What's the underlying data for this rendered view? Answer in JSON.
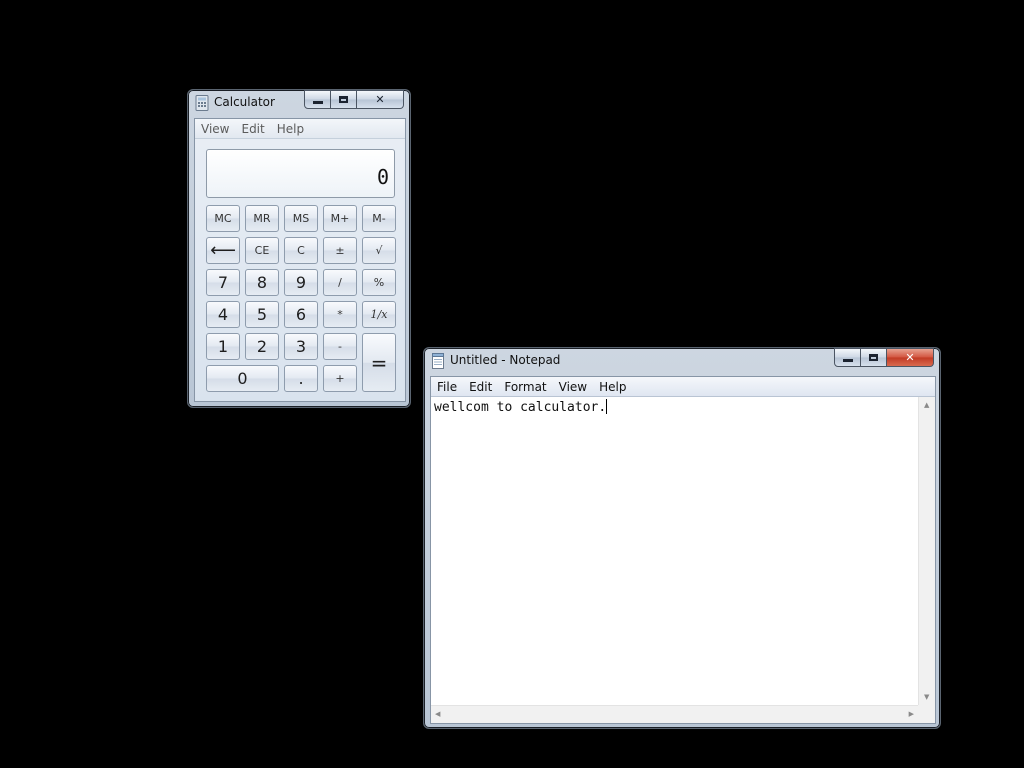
{
  "calculator": {
    "title": "Calculator",
    "menu": [
      "View",
      "Edit",
      "Help"
    ],
    "display_value": "0",
    "buttons": {
      "mc": "MC",
      "mr": "MR",
      "ms": "MS",
      "mplus": "M+",
      "mminus": "M-",
      "backspace": "⟵",
      "ce": "CE",
      "c": "C",
      "plusminus": "±",
      "sqrt": "√",
      "n7": "7",
      "n8": "8",
      "n9": "9",
      "divide": "/",
      "percent": "%",
      "n4": "4",
      "n5": "5",
      "n6": "6",
      "multiply": "*",
      "reciprocal": "1/x",
      "n1": "1",
      "n2": "2",
      "n3": "3",
      "minus": "-",
      "equals": "=",
      "n0": "0",
      "decimal": ".",
      "plus": "+"
    }
  },
  "notepad": {
    "title": "Untitled - Notepad",
    "menu": [
      "File",
      "Edit",
      "Format",
      "View",
      "Help"
    ],
    "content": "wellcom to calculator."
  },
  "icons": {
    "minimize": "minimize-icon",
    "maximize": "maximize-icon",
    "close": "close-icon",
    "calculator_app": "calculator-icon",
    "notepad_app": "notepad-icon",
    "scroll_up": "scroll-up-arrow-icon",
    "scroll_down": "scroll-down-arrow-icon",
    "scroll_left": "scroll-left-arrow-icon",
    "scroll_right": "scroll-right-arrow-icon"
  },
  "colors": {
    "desktop": "#000000",
    "close_button_active": "#c13a24"
  }
}
